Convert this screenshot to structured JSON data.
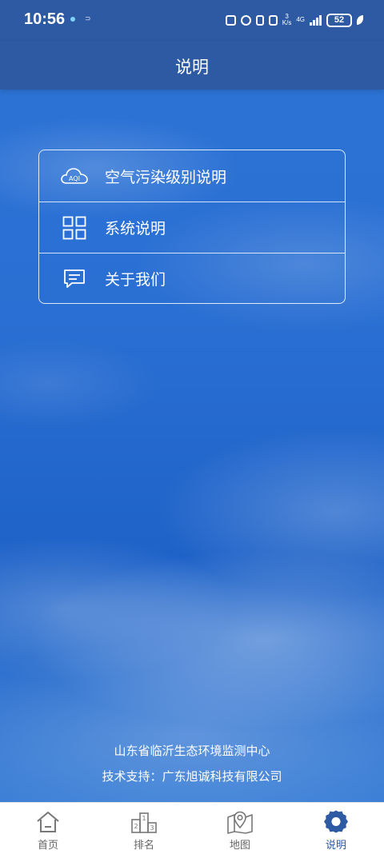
{
  "status_bar": {
    "time": "10:56",
    "small_label": "⊃",
    "net_speed_top": "3",
    "net_speed_bottom": "K/s",
    "network": "4G",
    "battery": "52"
  },
  "header": {
    "title": "说明"
  },
  "menu": {
    "items": [
      {
        "label": "空气污染级别说明",
        "icon": "aqi-cloud-icon"
      },
      {
        "label": "系统说明",
        "icon": "grid-icon"
      },
      {
        "label": "关于我们",
        "icon": "message-icon"
      }
    ],
    "aqi_icon_text": "AQI"
  },
  "footer": {
    "org": "山东省临沂生态环境监测中心",
    "support": "技术支持：广东旭诚科技有限公司"
  },
  "tabbar": {
    "items": [
      {
        "label": "首页",
        "icon": "home-icon"
      },
      {
        "label": "排名",
        "icon": "podium-icon"
      },
      {
        "label": "地图",
        "icon": "map-pin-icon"
      },
      {
        "label": "说明",
        "icon": "gear-icon",
        "active": true
      }
    ],
    "podium_digits": [
      "2",
      "1",
      "3"
    ]
  },
  "colors": {
    "brand": "#2e5aa3",
    "inactive": "#666666"
  }
}
